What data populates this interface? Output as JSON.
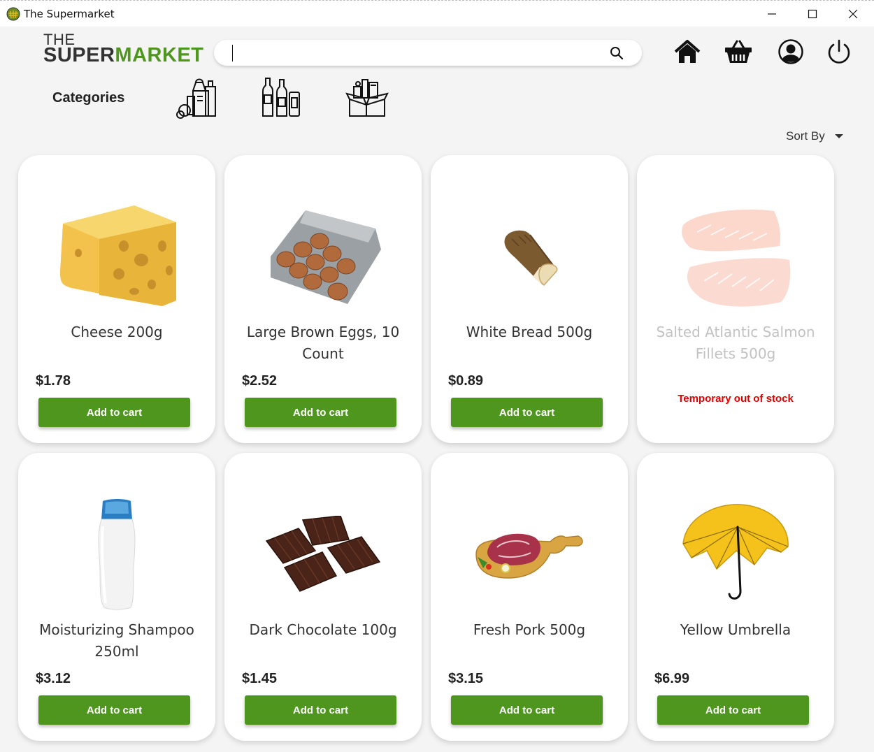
{
  "window": {
    "title": "The Supermarket"
  },
  "logo": {
    "the": "THE",
    "super": "SUPER",
    "market": "MARKET"
  },
  "search": {
    "placeholder": "",
    "value": ""
  },
  "nav": [
    "home-icon",
    "basket-icon",
    "user-icon",
    "power-icon"
  ],
  "categories": {
    "label": "Categories",
    "items": [
      "groceries-icon",
      "drinks-icon",
      "household-box-icon"
    ]
  },
  "sort": {
    "label": "Sort By"
  },
  "colors": {
    "brand_green": "#4f961f",
    "out_of_stock_red": "#e00000"
  },
  "products": [
    {
      "name": "Cheese 200g",
      "price": "$1.78",
      "button": "Add to cart",
      "in_stock": true,
      "image": "cheese"
    },
    {
      "name": "Large Brown Eggs, 10 Count",
      "price": "$2.52",
      "button": "Add to cart",
      "in_stock": true,
      "image": "eggs"
    },
    {
      "name": "White Bread 500g",
      "price": "$0.89",
      "button": "Add to cart",
      "in_stock": true,
      "image": "bread"
    },
    {
      "name": "Salted Atlantic Salmon Fillets 500g",
      "price": "",
      "status": "Temporary out of stock",
      "in_stock": false,
      "image": "salmon"
    },
    {
      "name": "Moisturizing Shampoo 250ml",
      "price": "$3.12",
      "button": "Add to cart",
      "in_stock": true,
      "image": "shampoo"
    },
    {
      "name": "Dark Chocolate 100g",
      "price": "$1.45",
      "button": "Add to cart",
      "in_stock": true,
      "image": "chocolate"
    },
    {
      "name": "Fresh Pork 500g",
      "price": "$3.15",
      "button": "Add to cart",
      "in_stock": true,
      "image": "pork"
    },
    {
      "name": "Yellow Umbrella",
      "price": "$6.99",
      "button": "Add to cart",
      "in_stock": true,
      "image": "umbrella"
    }
  ]
}
